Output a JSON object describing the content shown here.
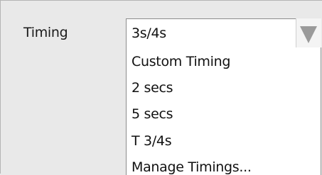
{
  "timing_field": {
    "label": "Timing",
    "selected_value": "3s/4s",
    "options": [
      "Custom Timing",
      "2 secs",
      "5 secs",
      "T 3/4s",
      "Manage Timings..."
    ]
  },
  "icons": {
    "dropdown_arrow": "triangle-down-icon"
  },
  "colors": {
    "background": "#e9e9e9",
    "field_background": "#ffffff",
    "border": "#8c8c8c",
    "arrow": "#9a9a9a"
  }
}
